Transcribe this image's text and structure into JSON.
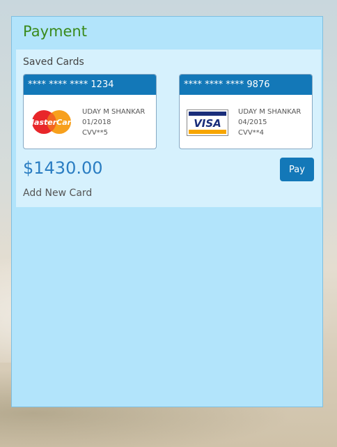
{
  "panel": {
    "title": "Payment"
  },
  "saved": {
    "label": "Saved Cards",
    "cards": [
      {
        "masked_number": "**** **** **** 1234",
        "brand": "MasterCard",
        "brand_icon": "mastercard-logo-icon",
        "name": "UDAY M SHANKAR",
        "expiry": "01/2018",
        "cvv": "CVV**5"
      },
      {
        "masked_number": "**** **** **** 9876",
        "brand": "VISA",
        "brand_icon": "visa-logo-icon",
        "name": "UDAY M SHANKAR",
        "expiry": "04/2015",
        "cvv": "CVV**4"
      }
    ]
  },
  "amount": "$1430.00",
  "pay_button": "Pay",
  "add_card_link": "Add New Card",
  "colors": {
    "accent": "#1378b8",
    "title_green": "#3a8a1c",
    "amount_blue": "#2a7dc2",
    "panel_bg": "#b2e4fb"
  }
}
